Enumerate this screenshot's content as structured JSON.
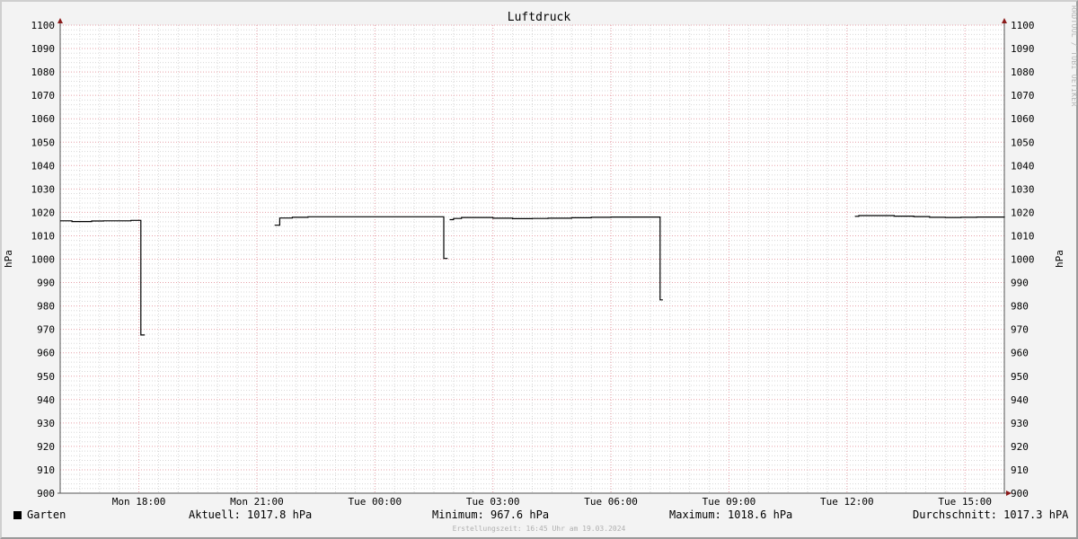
{
  "watermark": "RRDTOOL / TOBI OETIKER",
  "footer": {
    "legend_label": "Garten",
    "current": "Aktuell: 1017.8 hPa",
    "minimum": "Minimum: 967.6 hPa",
    "maximum": "Maximum: 1018.6 hPa",
    "average": "Durchschnitt: 1017.3 hPA",
    "created": "Erstellungszeit: 16:45 Uhr am 19.03.2024"
  },
  "colors": {
    "line": "#000000",
    "major_grid": "#e6a0a8",
    "minor_grid": "#d8d8d8",
    "axis": "#555555",
    "arrow": "#8b1a1a"
  },
  "chart_data": {
    "type": "line",
    "title": "Luftdruck",
    "ylabel": "hPa",
    "ylabel_right": "hPa",
    "ylim": [
      900,
      1100
    ],
    "xlim_hours": [
      16.0,
      40.0
    ],
    "yticks": [
      900,
      910,
      920,
      930,
      940,
      950,
      960,
      970,
      980,
      990,
      1000,
      1010,
      1020,
      1030,
      1040,
      1050,
      1060,
      1070,
      1080,
      1090,
      1100
    ],
    "xticks": [
      {
        "label": "Mon 18:00",
        "hour": 18
      },
      {
        "label": "Mon 21:00",
        "hour": 21
      },
      {
        "label": "Tue 00:00",
        "hour": 24
      },
      {
        "label": "Tue 03:00",
        "hour": 27
      },
      {
        "label": "Tue 06:00",
        "hour": 30
      },
      {
        "label": "Tue 09:00",
        "hour": 33
      },
      {
        "label": "Tue 12:00",
        "hour": 36
      },
      {
        "label": "Tue 15:00",
        "hour": 39
      }
    ],
    "grid": true,
    "series": [
      {
        "name": "Garten",
        "segments": [
          [
            [
              16.0,
              1016.4
            ],
            [
              16.2,
              1016.4
            ],
            [
              16.3,
              1016.1
            ],
            [
              16.5,
              1016.1
            ],
            [
              16.8,
              1016.3
            ],
            [
              17.1,
              1016.4
            ],
            [
              17.4,
              1016.4
            ],
            [
              17.8,
              1016.6
            ],
            [
              18.0,
              1016.6
            ],
            [
              18.05,
              967.6
            ],
            [
              18.15,
              967.6
            ]
          ],
          [
            [
              21.45,
              1014.5
            ],
            [
              21.55,
              1014.5
            ],
            [
              21.58,
              1017.6
            ],
            [
              21.9,
              1017.9
            ],
            [
              22.3,
              1018.1
            ],
            [
              22.8,
              1018.1
            ],
            [
              23.3,
              1018.1
            ],
            [
              24.0,
              1018.1
            ],
            [
              25.0,
              1018.1
            ],
            [
              25.7,
              1018.1
            ],
            [
              25.75,
              1000.3
            ],
            [
              25.85,
              1000.3
            ]
          ],
          [
            [
              25.9,
              1016.9
            ],
            [
              26.0,
              1017.4
            ],
            [
              26.2,
              1017.8
            ],
            [
              26.5,
              1017.8
            ],
            [
              27.0,
              1017.5
            ],
            [
              27.5,
              1017.3
            ],
            [
              28.0,
              1017.4
            ],
            [
              28.4,
              1017.5
            ],
            [
              29.0,
              1017.7
            ],
            [
              29.5,
              1017.9
            ],
            [
              30.0,
              1018.0
            ],
            [
              30.6,
              1018.0
            ],
            [
              31.2,
              1018.0
            ],
            [
              31.25,
              982.6
            ],
            [
              31.32,
              982.6
            ]
          ],
          [
            [
              36.2,
              1018.3
            ],
            [
              36.3,
              1018.6
            ],
            [
              36.8,
              1018.6
            ],
            [
              37.2,
              1018.4
            ],
            [
              37.7,
              1018.2
            ],
            [
              38.1,
              1017.9
            ],
            [
              38.5,
              1017.8
            ],
            [
              38.9,
              1017.9
            ],
            [
              39.3,
              1018.0
            ],
            [
              39.6,
              1018.0
            ],
            [
              40.0,
              1017.8
            ]
          ]
        ]
      }
    ]
  }
}
